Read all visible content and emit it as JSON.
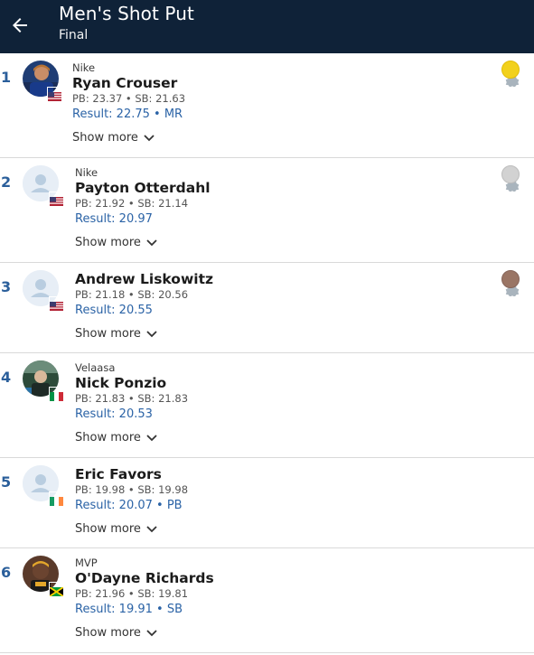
{
  "header": {
    "title": "Men's Shot Put",
    "subtitle": "Final"
  },
  "athletes": [
    {
      "rank": "1",
      "team": "Nike",
      "name": "Ryan Crouser",
      "stats": "PB: 23.37 • SB: 21.63",
      "result": "Result: 22.75 • MR",
      "show_more": "Show more",
      "medal": "gold",
      "flag": "usa",
      "avatar": "photo"
    },
    {
      "rank": "2",
      "team": "Nike",
      "name": "Payton Otterdahl",
      "stats": "PB: 21.92 • SB: 21.14",
      "result": "Result: 20.97",
      "show_more": "Show more",
      "medal": "silver",
      "flag": "usa",
      "avatar": "placeholder"
    },
    {
      "rank": "3",
      "team": "",
      "name": "Andrew Liskowitz",
      "stats": "PB: 21.18 • SB: 20.56",
      "result": "Result: 20.55",
      "show_more": "Show more",
      "medal": "bronze",
      "flag": "usa",
      "avatar": "placeholder"
    },
    {
      "rank": "4",
      "team": "Velaasa",
      "name": "Nick Ponzio",
      "stats": "PB: 21.83 • SB: 21.83",
      "result": "Result: 20.53",
      "show_more": "Show more",
      "medal": "",
      "flag": "ita",
      "avatar": "photo"
    },
    {
      "rank": "5",
      "team": "",
      "name": "Eric Favors",
      "stats": "PB: 19.98 • SB: 19.98",
      "result": "Result: 20.07 • PB",
      "show_more": "Show more",
      "medal": "",
      "flag": "irl",
      "avatar": "placeholder"
    },
    {
      "rank": "6",
      "team": "MVP",
      "name": "O'Dayne Richards",
      "stats": "PB: 21.96 • SB: 19.81",
      "result": "Result: 19.91 • SB",
      "show_more": "Show more",
      "medal": "",
      "flag": "jam",
      "avatar": "photo"
    }
  ],
  "colors": {
    "header_bg": "#0f2238",
    "accent": "#2b63a6",
    "gold": "#f2d11c",
    "silver": "#d2d2d2",
    "bronze": "#9a7565"
  }
}
